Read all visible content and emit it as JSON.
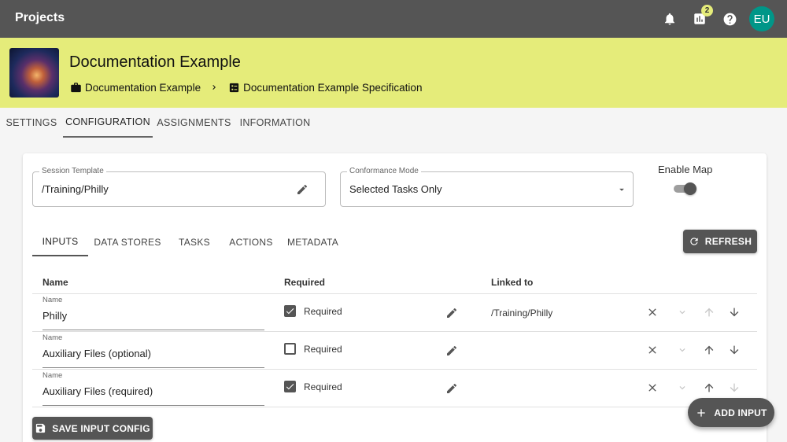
{
  "app": {
    "title": "Projects",
    "avatar_initials": "EU",
    "notification_badge": "2"
  },
  "header": {
    "title": "Documentation Example",
    "breadcrumb": [
      "Documentation Example",
      "Documentation Example Specification"
    ]
  },
  "tabs": [
    "SETTINGS",
    "CONFIGURATION",
    "ASSIGNMENTS",
    "INFORMATION"
  ],
  "active_tab": "CONFIGURATION",
  "config": {
    "session_template": {
      "label": "Session Template",
      "value": "/Training/Philly"
    },
    "conformance_mode": {
      "label": "Conformance Mode",
      "value": "Selected Tasks Only"
    },
    "enable_map": {
      "label": "Enable Map",
      "on": true
    }
  },
  "subtabs": [
    "INPUTS",
    "DATA STORES",
    "TASKS",
    "ACTIONS",
    "METADATA"
  ],
  "active_subtab": "INPUTS",
  "refresh_label": "REFRESH",
  "table": {
    "headers": {
      "name": "Name",
      "required": "Required",
      "linked": "Linked to"
    },
    "rows": [
      {
        "name_label": "Name",
        "name": "Philly",
        "required": true,
        "required_label": "Required",
        "linked_to": "/Training/Philly"
      },
      {
        "name_label": "Name",
        "name": "Auxiliary Files (optional)",
        "required": false,
        "required_label": "Required",
        "linked_to": ""
      },
      {
        "name_label": "Name",
        "name": "Auxiliary Files (required)",
        "required": true,
        "required_label": "Required",
        "linked_to": ""
      }
    ]
  },
  "buttons": {
    "save_input_config": "SAVE INPUT CONFIG",
    "add_input": "ADD INPUT"
  },
  "icons": {
    "top_bar": [
      "bell-icon",
      "bar-chart-icon",
      "help-icon"
    ],
    "row_actions": [
      "close-icon",
      "chevron-down-icon",
      "arrow-up-icon",
      "arrow-down-icon"
    ]
  }
}
